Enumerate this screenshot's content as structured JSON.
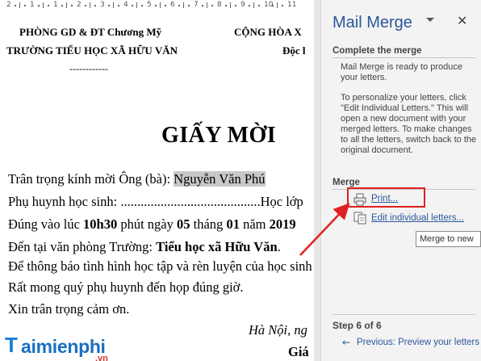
{
  "ruler": {
    "numbers": [
      "2",
      "1",
      "1",
      "2",
      "3",
      "4",
      "5",
      "6",
      "7",
      "8",
      "9",
      "10",
      "11"
    ]
  },
  "document": {
    "header_left_1": "PHÒNG GD & ĐT Chương Mỹ",
    "header_left_2": "TRƯỜNG TIỂU HỌC XÃ HỮU VĂN",
    "header_dashes": "------------",
    "header_right_1": "CỘNG HÒA X",
    "header_right_2": "Độc l",
    "title": "GIẤY MỜI",
    "line1_prefix": "Trân trọng kính mời Ông (bà): ",
    "line1_field": "Nguyễn Văn Phú",
    "line2": "Phụ huynh học sinh: ..........................................Học lớp",
    "line3_a": "Đúng vào lúc ",
    "line3_b": "10h30",
    "line3_c": " phút ngày ",
    "line3_d": "05",
    "line3_e": " tháng ",
    "line3_f": "01",
    "line3_g": " năm ",
    "line3_h": "2019",
    "line4_a": "Đến tại văn phòng Trường: ",
    "line4_b": "Tiểu học xã Hữu Văn",
    "line4_c": ".",
    "line5": "Để thông báo tình hình học tập và rèn luyện của học sinh",
    "line6": "Rất mong quý phụ huynh đến họp đúng giờ.",
    "line7": "Xin trân trọng cảm ơn.",
    "line8": "Hà Nội, ng",
    "line9": "Giá"
  },
  "logo": {
    "letter": "T",
    "rest": "aimienphi",
    "suffix": ".vn"
  },
  "panel": {
    "title": "Mail Merge",
    "close": "✕",
    "section1_title": "Complete the merge",
    "section1_text1": "Mail Merge is ready to produce your letters.",
    "section1_text2": "To personalize your letters, click \"Edit Individual Letters.\" This will open a new document with your merged letters. To make changes to all the letters, switch back to the original document.",
    "section2_title": "Merge",
    "print_label": "Print...",
    "edit_label": "Edit individual letters...",
    "tooltip": "Merge to new",
    "step_label": "Step 6 of 6",
    "previous_label": "Previous: Preview your letters",
    "previous_arrow": "←"
  },
  "colors": {
    "accent": "#2b579a",
    "annotation": "#e02020"
  }
}
